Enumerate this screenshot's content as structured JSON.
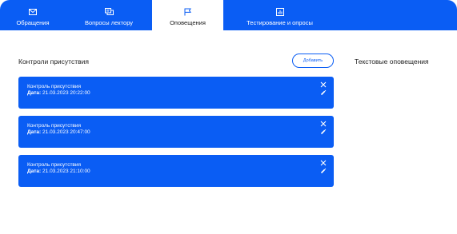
{
  "tabs": [
    {
      "label": "Обращения",
      "icon": "mail-icon"
    },
    {
      "label": "Вопросы лектору",
      "icon": "chat-icon"
    },
    {
      "label": "Оповещения",
      "icon": "flag-icon"
    },
    {
      "label": "Тестирование и опросы",
      "icon": "chart-icon"
    }
  ],
  "attendance": {
    "title": "Контроли присутствия",
    "add_label": "Добавить",
    "cards": [
      {
        "title": "Контроль присутствия",
        "date_label": "Дата:",
        "date_value": "21.03.2023 20:22:00"
      },
      {
        "title": "Контроль присутствия",
        "date_label": "Дата:",
        "date_value": "21.03.2023 20:47:00"
      },
      {
        "title": "Контроль присутствия",
        "date_label": "Дата:",
        "date_value": "21.03.2023 21:10:00"
      }
    ]
  },
  "text_alerts": {
    "title": "Текстовые оповещения"
  },
  "colors": {
    "accent": "#0a5df4"
  }
}
